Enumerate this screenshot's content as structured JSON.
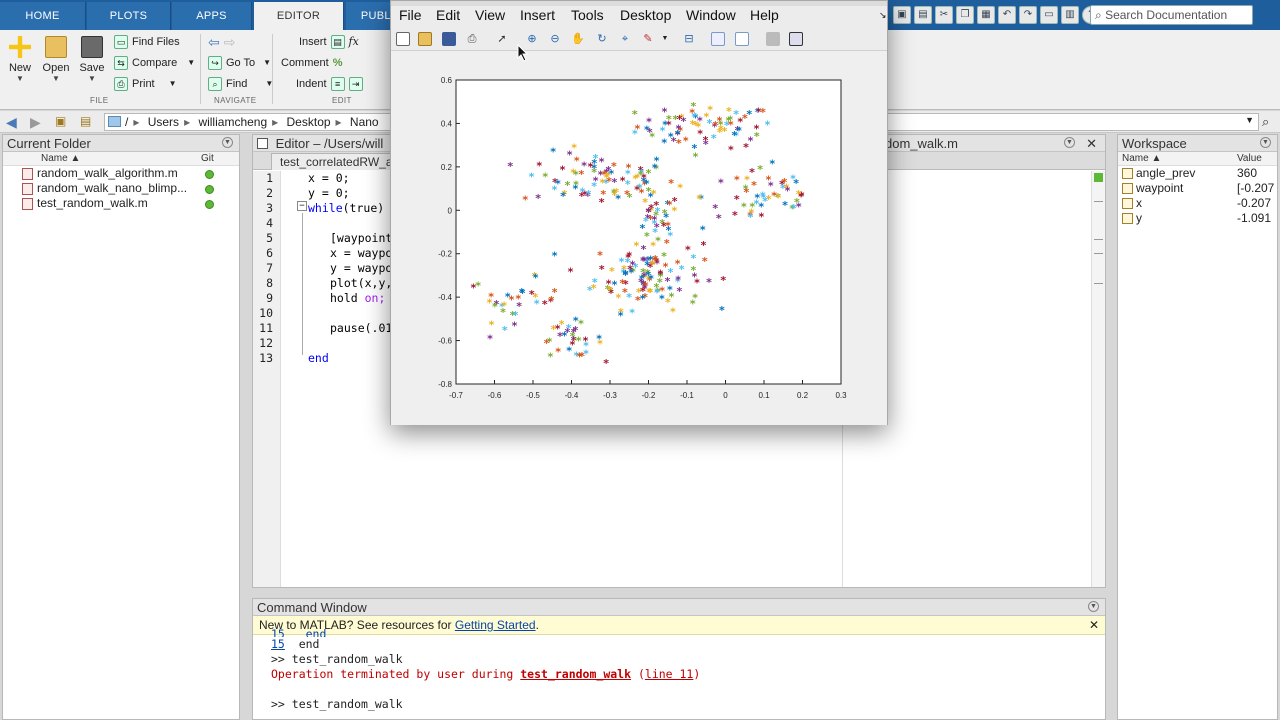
{
  "tabs": [
    "HOME",
    "PLOTS",
    "APPS",
    "EDITOR",
    "PUBLISH"
  ],
  "search_doc": "Search Documentation",
  "ribbon": {
    "new": "New",
    "open": "Open",
    "save": "Save",
    "find_files": "Find Files",
    "compare": "Compare",
    "print": "Print",
    "go_to": "Go To",
    "find": "Find",
    "insert": "Insert",
    "comment": "Comment",
    "indent": "Indent",
    "section_file": "FILE",
    "section_navigate": "NAVIGATE",
    "section_edit": "EDIT"
  },
  "breadcrumb": [
    "/",
    "Users",
    "williamcheng",
    "Desktop",
    "Nano"
  ],
  "current_folder": {
    "title": "Current Folder",
    "col_name": "Name ▲",
    "col_git": "Git",
    "files": [
      "random_walk_algorithm.m",
      "random_walk_nano_blimp...",
      "test_random_walk.m"
    ]
  },
  "editor": {
    "title": "Editor – /Users/will",
    "tab": "test_correlatedRW_a",
    "second_title": "dom_walk.m",
    "line_numbers": [
      "1",
      "2",
      "3",
      "4",
      "5",
      "6",
      "7",
      "8",
      "9",
      "10",
      "11",
      "12",
      "13"
    ],
    "lines": {
      "l1": "x = 0;",
      "l2": "y = 0;",
      "l3_kw": "while",
      "l3_rest": "(true)",
      "l5": "[waypoint",
      "l6": "x = waypo",
      "l7": "y = waypo",
      "l8": "plot(x,y,",
      "l9_a": "hold ",
      "l9_b": "on;",
      "l11": "pause(.01",
      "l13": "end"
    }
  },
  "figure": {
    "menu": [
      "File",
      "Edit",
      "View",
      "Insert",
      "Tools",
      "Desktop",
      "Window",
      "Help"
    ]
  },
  "chart_data": {
    "type": "scatter",
    "title": "",
    "xlabel": "",
    "ylabel": "",
    "xlim": [
      -0.7,
      0.3
    ],
    "ylim": [
      -0.8,
      0.6
    ],
    "xticks": [
      "-0.7",
      "-0.6",
      "-0.5",
      "-0.4",
      "-0.3",
      "-0.2",
      "-0.1",
      "0",
      "0.1",
      "0.2",
      "0.3"
    ],
    "yticks": [
      "0.6",
      "0.4",
      "0.2",
      "0",
      "-0.2",
      "-0.4",
      "-0.6",
      "-0.8"
    ],
    "marker": "*",
    "colors": [
      "#0072bd",
      "#d95319",
      "#edb120",
      "#7e2f8e",
      "#77ac30",
      "#4dbeee",
      "#a2142f"
    ],
    "grid": false,
    "clusters": [
      {
        "cx": -0.05,
        "cy": 0.38,
        "sx": 0.09,
        "sy": 0.05,
        "n": 70
      },
      {
        "cx": -0.33,
        "cy": 0.14,
        "sx": 0.1,
        "sy": 0.06,
        "n": 80
      },
      {
        "cx": -0.2,
        "cy": -0.3,
        "sx": 0.07,
        "sy": 0.08,
        "n": 110
      },
      {
        "cx": -0.55,
        "cy": -0.42,
        "sx": 0.06,
        "sy": 0.05,
        "n": 30
      },
      {
        "cx": -0.4,
        "cy": -0.6,
        "sx": 0.04,
        "sy": 0.04,
        "n": 30
      },
      {
        "cx": 0.1,
        "cy": 0.06,
        "sx": 0.08,
        "sy": 0.08,
        "n": 50
      },
      {
        "cx": -0.18,
        "cy": -0.05,
        "sx": 0.03,
        "sy": 0.06,
        "n": 30
      }
    ]
  },
  "command_window": {
    "title": "Command Window",
    "notice_pre": "New to MATLAB? See resources for ",
    "notice_link": "Getting Started",
    "notice_post": ".",
    "line0": "15   end",
    "line1_num": "15",
    "line1_text": "  end",
    "line2": ">> test_random_walk",
    "err_pre": "Operation terminated by user during ",
    "err_fn": "test_random_walk",
    "err_open": " (",
    "err_line": "line 11",
    "err_close": ")",
    "line4": ">> test_random_walk"
  },
  "workspace": {
    "title": "Workspace",
    "col_name": "Name ▲",
    "col_value": "Value",
    "vars": [
      {
        "name": "angle_prev",
        "value": "360"
      },
      {
        "name": "waypoint",
        "value": "[-0.207"
      },
      {
        "name": "x",
        "value": "-0.207"
      },
      {
        "name": "y",
        "value": "-1.091"
      }
    ]
  }
}
